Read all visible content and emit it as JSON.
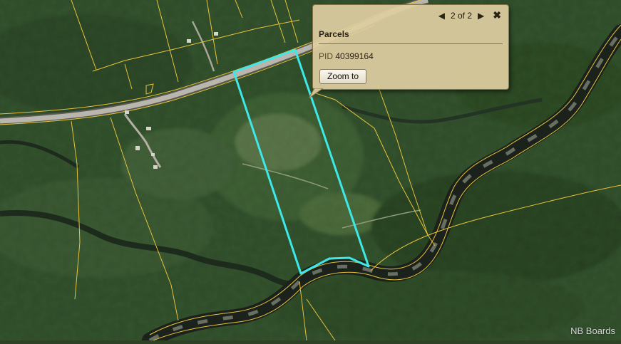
{
  "popup": {
    "pager": "2 of 2",
    "prev_icon": "caret-left-icon",
    "next_icon": "caret-right-icon",
    "close_icon": "close-icon",
    "layer_title": "Parcels",
    "pid_label": "PID",
    "pid_value": "40399164",
    "zoom_label": "Zoom to"
  },
  "map": {
    "selected_parcel_color": "#3de8e8",
    "parcel_line_color": "#e8c23a"
  },
  "watermark": "NB Boards"
}
